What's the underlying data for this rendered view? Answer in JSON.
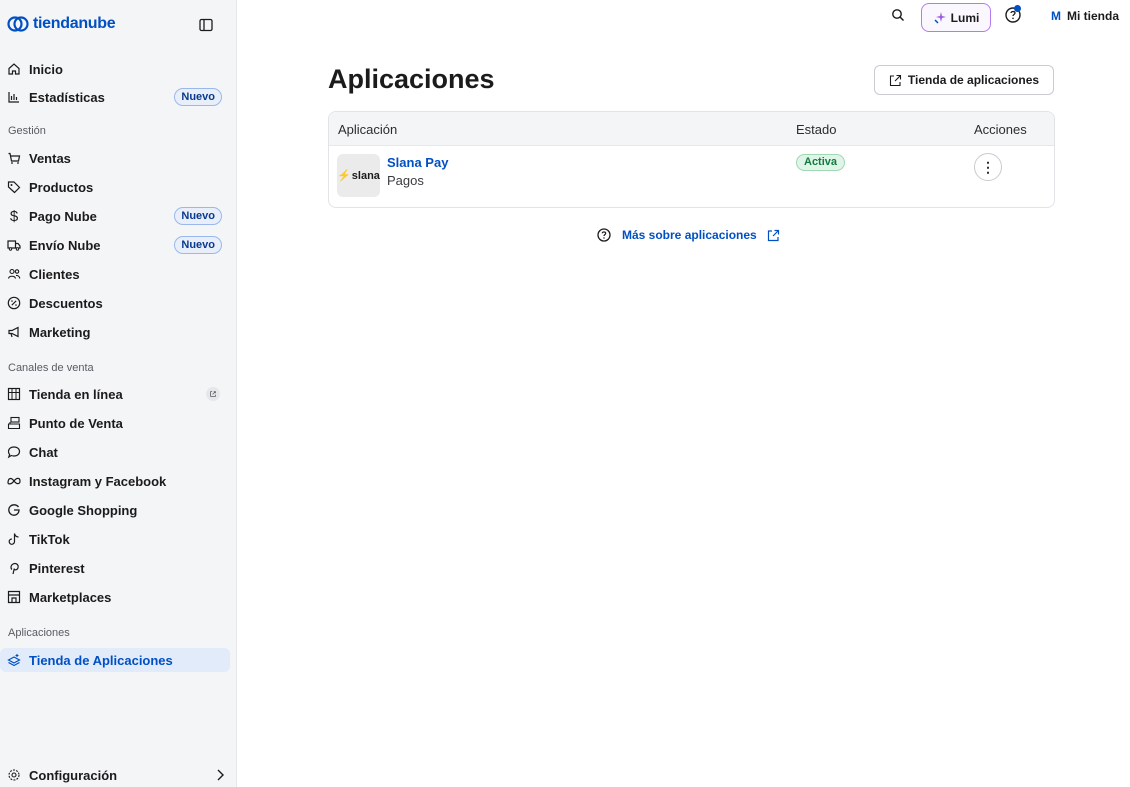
{
  "brand": {
    "name": "tiendanube"
  },
  "sidebar": {
    "items": [
      {
        "label": "Inicio",
        "icon": "home-icon"
      },
      {
        "label": "Estadísticas",
        "icon": "chart-icon",
        "badge": "Nuevo"
      },
      {
        "label": "Ventas",
        "icon": "cart-icon"
      },
      {
        "label": "Productos",
        "icon": "tag-icon"
      },
      {
        "label": "Pago Nube",
        "icon": "dollar-icon",
        "badge": "Nuevo"
      },
      {
        "label": "Envío Nube",
        "icon": "truck-icon",
        "badge": "Nuevo"
      },
      {
        "label": "Clientes",
        "icon": "users-icon"
      },
      {
        "label": "Descuentos",
        "icon": "discount-icon"
      },
      {
        "label": "Marketing",
        "icon": "megaphone-icon"
      },
      {
        "label": "Tienda en línea",
        "icon": "store-icon"
      },
      {
        "label": "Punto de Venta",
        "icon": "pos-icon"
      },
      {
        "label": "Chat",
        "icon": "chat-icon"
      },
      {
        "label": "Instagram y Facebook",
        "icon": "meta-icon"
      },
      {
        "label": "Google Shopping",
        "icon": "google-icon"
      },
      {
        "label": "TikTok",
        "icon": "tiktok-icon"
      },
      {
        "label": "Pinterest",
        "icon": "pinterest-icon"
      },
      {
        "label": "Marketplaces",
        "icon": "marketplace-icon"
      },
      {
        "label": "Tienda de Aplicaciones",
        "icon": "apps-icon"
      }
    ],
    "sections": {
      "gestion": "Gestión",
      "canales": "Canales de venta",
      "aplicaciones": "Aplicaciones"
    },
    "config_label": "Configuración"
  },
  "topbar": {
    "lumi_label": "Lumi",
    "store_initial": "M",
    "store_name": "Mi tienda"
  },
  "main": {
    "title": "Aplicaciones",
    "store_button": "Tienda de aplicaciones",
    "table": {
      "headers": [
        "Aplicación",
        "Estado",
        "Acciones"
      ],
      "rows": [
        {
          "logo_text": "slana",
          "name": "Slana Pay",
          "category": "Pagos",
          "status": "Activa"
        }
      ]
    },
    "more_link": "Más sobre aplicaciones"
  },
  "colors": {
    "accent": "#0050c3",
    "active_bg": "#e1ebfa",
    "status_green": "#137a3f",
    "lumi_border": "#b47af0"
  }
}
